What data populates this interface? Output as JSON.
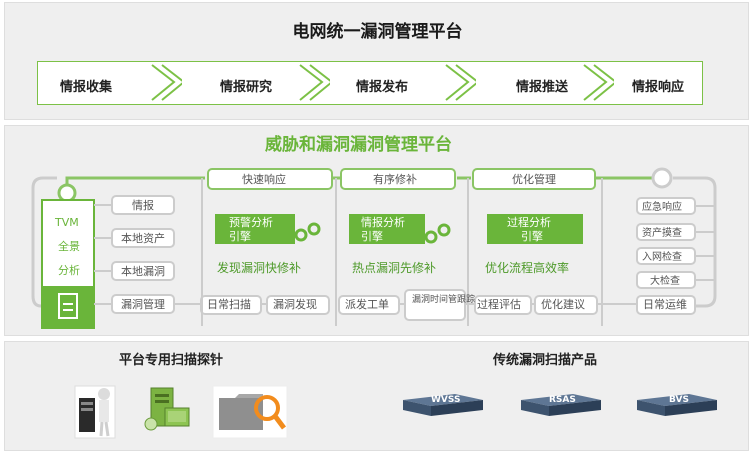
{
  "top": {
    "title": "电网统一漏洞管理平台",
    "flow": [
      "情报收集",
      "情报研究",
      "情报发布",
      "情报推送",
      "情报响应"
    ]
  },
  "middle": {
    "title": "威胁和漏洞漏洞管理平台",
    "tvm": [
      "TVM",
      "全景",
      "分析"
    ],
    "left_items": [
      "情报",
      "本地资产",
      "本地漏洞",
      "漏洞管理"
    ],
    "sections": [
      {
        "header": "快速响应",
        "engine": [
          "预警分析",
          "引擎"
        ],
        "caption": "发现漏洞快修补"
      },
      {
        "header": "有序修补",
        "engine": [
          "情报分析",
          "引擎"
        ],
        "caption": "热点漏洞先修补"
      },
      {
        "header": "优化管理",
        "engine": [
          "过程分析",
          "引擎"
        ],
        "caption": "优化流程高效率"
      }
    ],
    "bottom_row": [
      "日常扫描",
      "漏洞发现",
      "派发工单",
      "漏洞时间管跟踪",
      "过程评估",
      "优化建议",
      "日常运维"
    ],
    "right_items": [
      "应急响应",
      "资产摸查",
      "入网检查",
      "大检查"
    ]
  },
  "bottom": {
    "left_title": "平台专用扫描探针",
    "right_title": "传统漏洞扫描产品",
    "products": [
      "WVSS",
      "RSAS",
      "BVS"
    ]
  },
  "colors": {
    "accent": "#6ab53a",
    "dark_green": "#4e9a2a",
    "frame": "#c8c8c8"
  }
}
